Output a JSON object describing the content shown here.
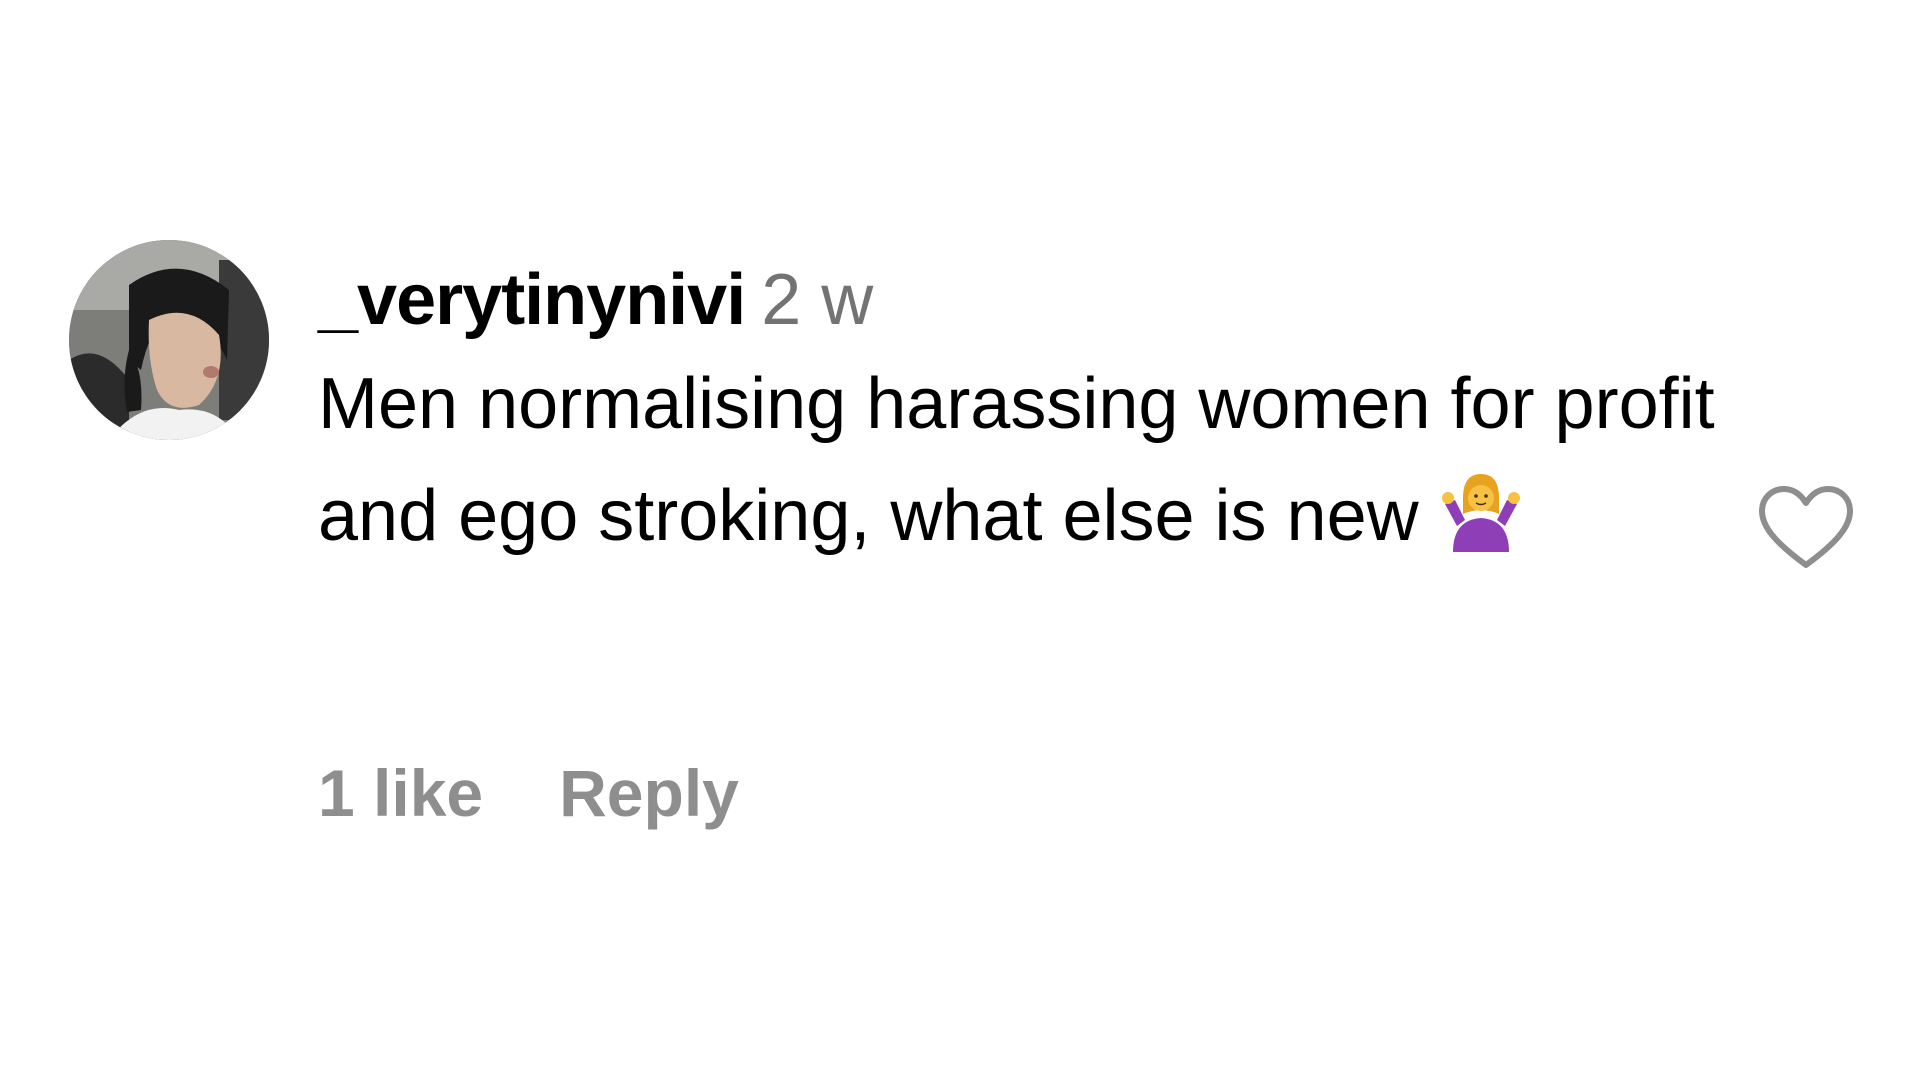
{
  "comment": {
    "username": "_verytinynivi",
    "timestamp": "2 w",
    "text": "Men normalising harassing women for profit and ego stroking, what else is new",
    "emoji_icon": "woman-shrugging-emoji",
    "likes_label": "1 like",
    "reply_label": "Reply",
    "like_icon": "heart-outline-icon",
    "avatar": "profile-photo"
  },
  "colors": {
    "text": "#000000",
    "timestamp": "#737373",
    "actions": "#8e8e8e",
    "heart_stroke": "#8e8e8e",
    "background": "#ffffff"
  }
}
